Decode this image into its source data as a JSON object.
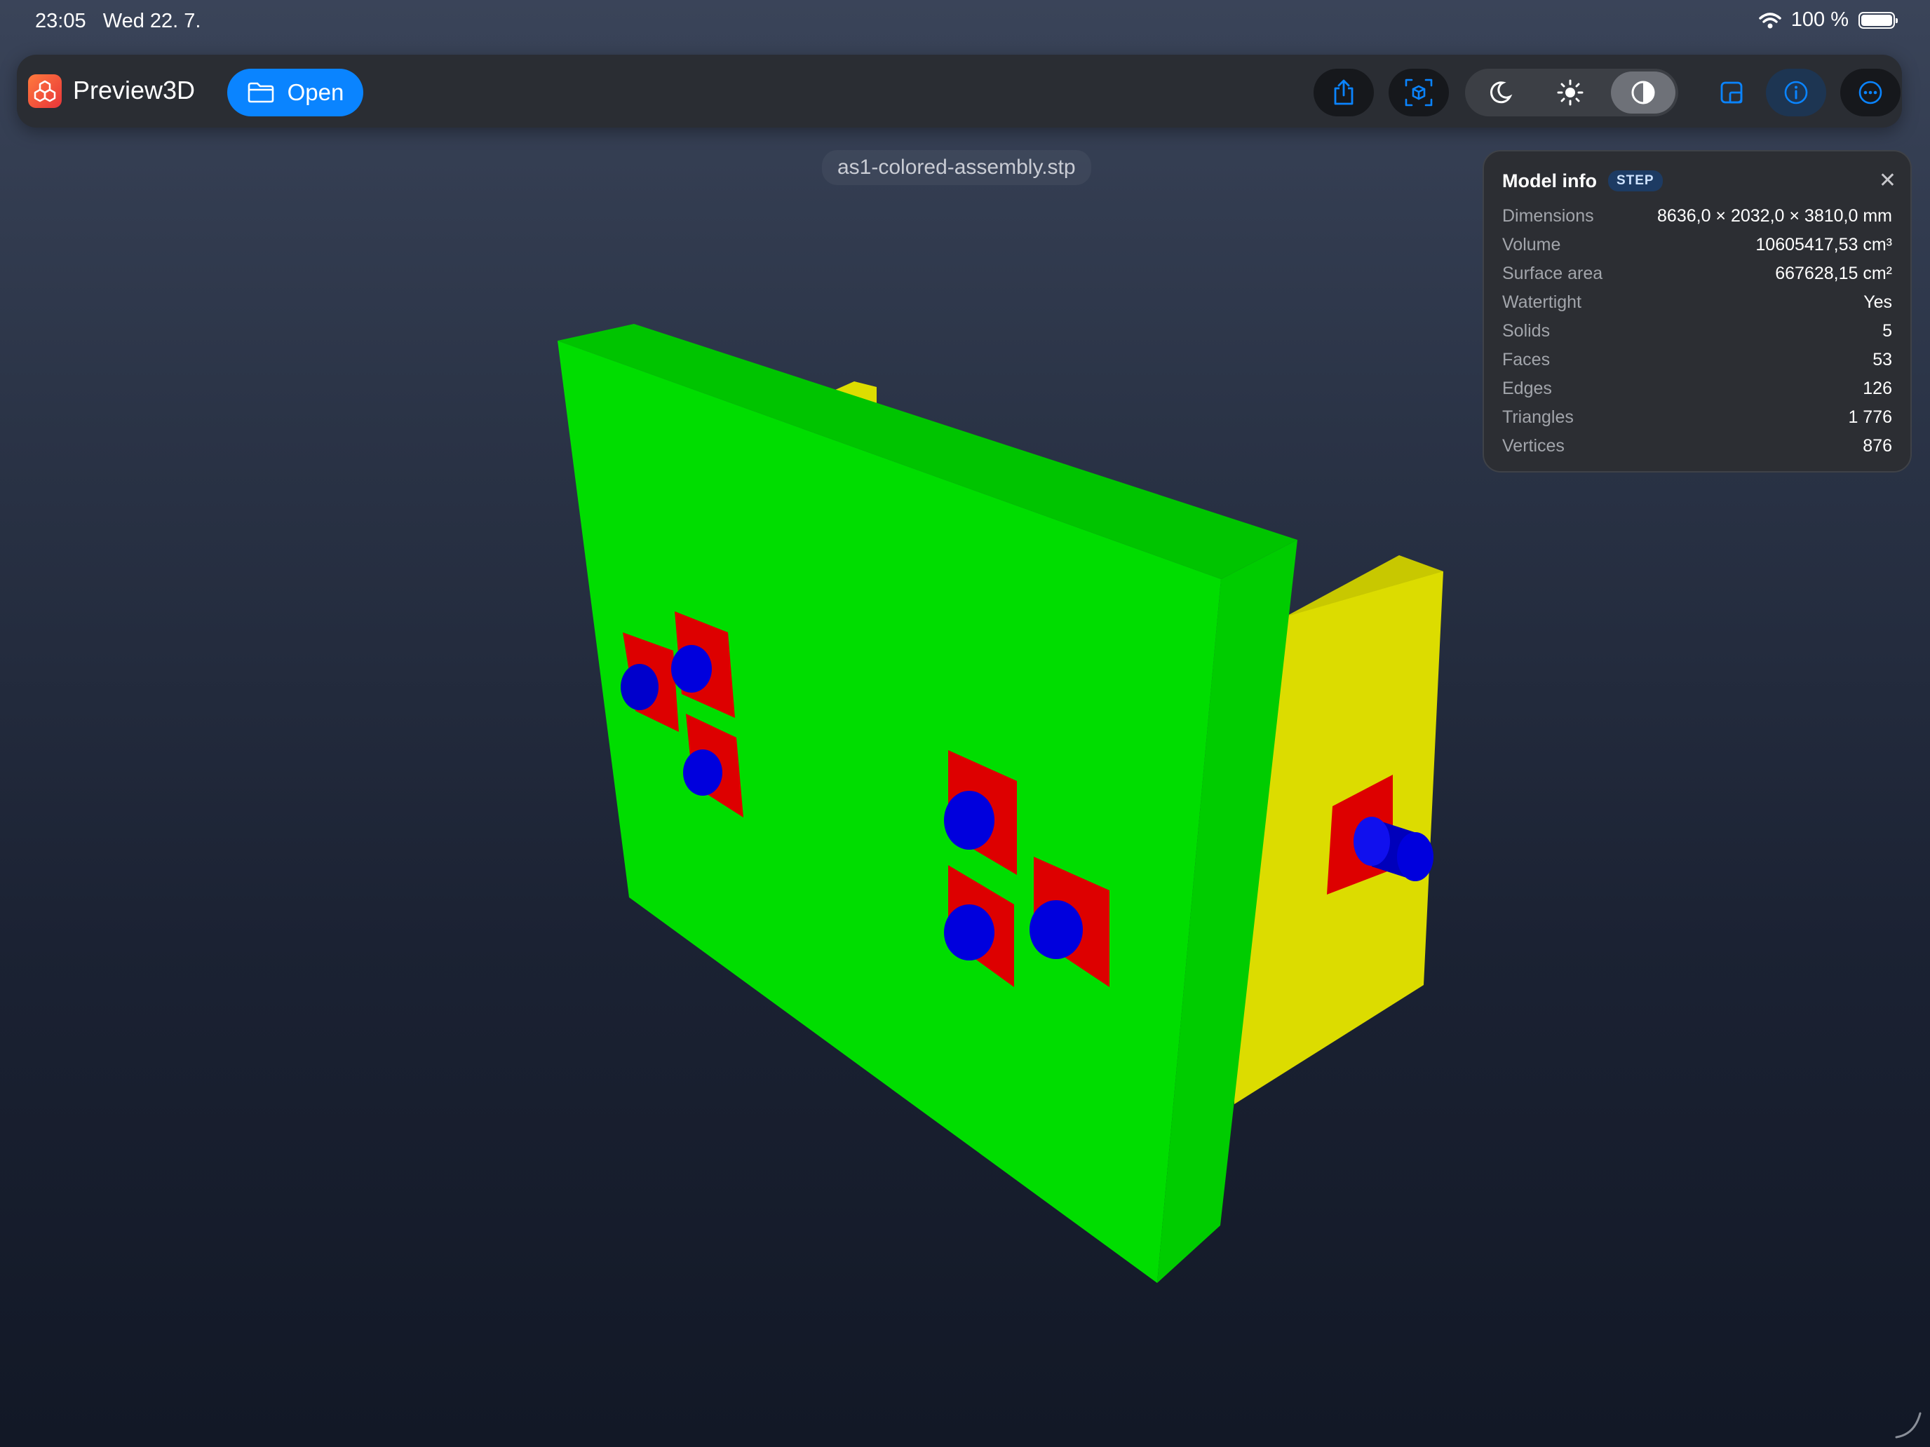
{
  "status": {
    "time": "23:05",
    "date": "Wed 22. 7.",
    "battery": "100 %"
  },
  "app": {
    "title": "Preview3D",
    "open_label": "Open"
  },
  "toolbar": {
    "icons": [
      "share-icon",
      "reset-view-icon",
      "moon-icon",
      "sun-icon",
      "contrast-icon",
      "panel-icon",
      "info-icon",
      "more-icon"
    ],
    "selected_theme": "contrast"
  },
  "file": {
    "name": "as1-colored-assembly.stp"
  },
  "model_info": {
    "title": "Model info",
    "format_badge": "STEP",
    "rows": [
      {
        "label": "Dimensions",
        "value": "8636,0 × 2032,0 × 3810,0 mm"
      },
      {
        "label": "Volume",
        "value": "10605417,53 cm³"
      },
      {
        "label": "Surface area",
        "value": "667628,15 cm²"
      },
      {
        "label": "Watertight",
        "value": "Yes"
      },
      {
        "label": "Solids",
        "value": "5"
      },
      {
        "label": "Faces",
        "value": "53"
      },
      {
        "label": "Edges",
        "value": "126"
      },
      {
        "label": "Triangles",
        "value": "1 776"
      },
      {
        "label": "Vertices",
        "value": "876"
      }
    ]
  },
  "colors": {
    "accent": "#0a84ff",
    "plate": "#00dd00",
    "bracket": "#dddd00",
    "pad": "#dd0000",
    "pin": "#0000dd"
  }
}
